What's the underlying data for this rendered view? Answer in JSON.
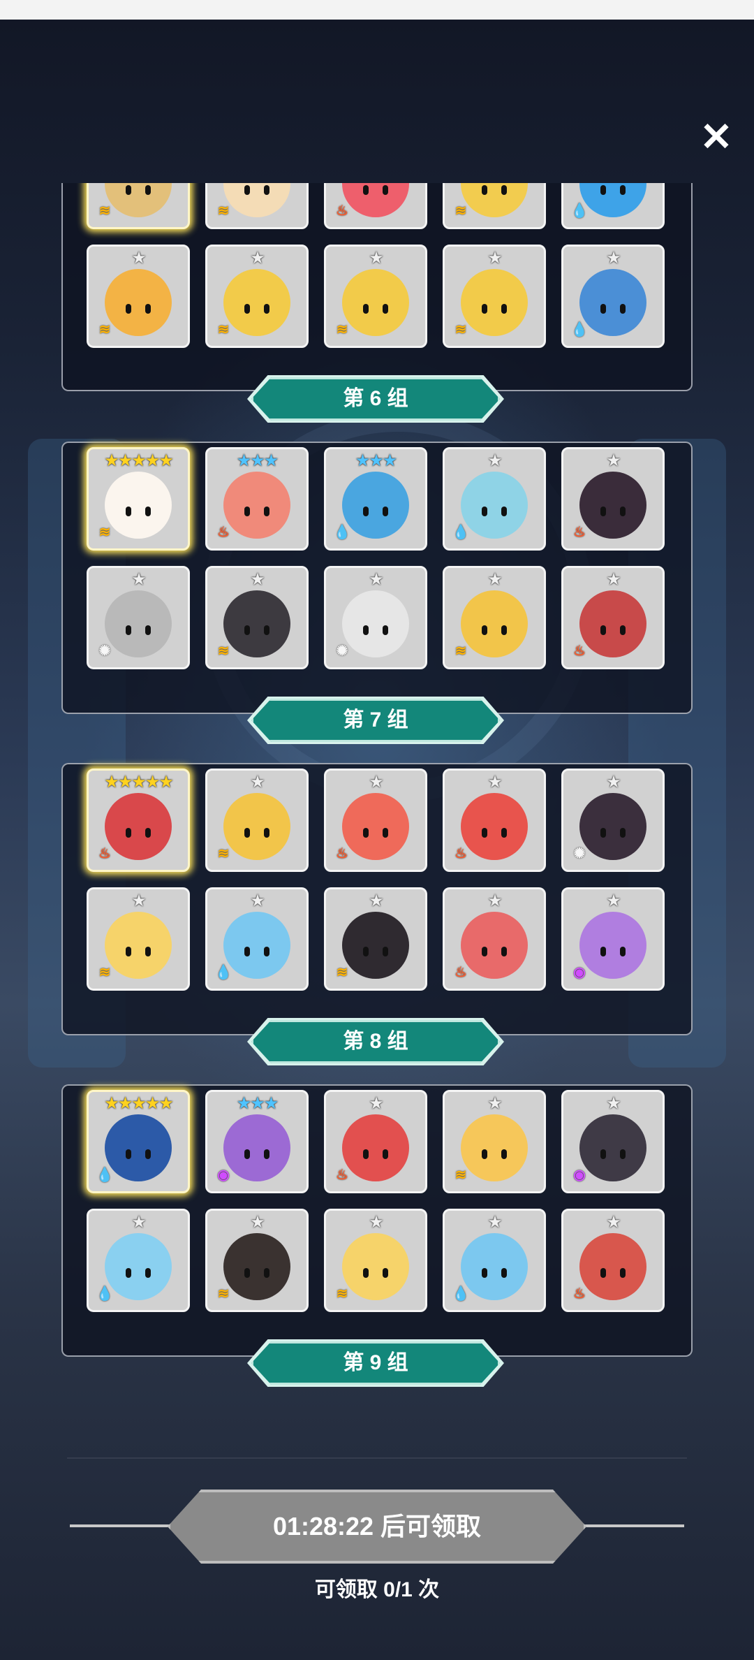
{
  "close_glyph": "✕",
  "groups": [
    {
      "label": "第 6 组",
      "cards": [
        {
          "stars": "★★★★★",
          "star_color": "gold",
          "element": "wind",
          "color": "#e3c07a",
          "glow": true
        },
        {
          "stars": "★★★",
          "star_color": "blue",
          "element": "wind",
          "color": "#f4dcb6",
          "glow": false
        },
        {
          "stars": "★",
          "star_color": "white",
          "element": "fire",
          "color": "#ee5f6c",
          "glow": false
        },
        {
          "stars": "★",
          "star_color": "white",
          "element": "wind",
          "color": "#f2cc4f",
          "glow": false
        },
        {
          "stars": "★",
          "star_color": "white",
          "element": "water",
          "color": "#3ea3e8",
          "glow": false
        },
        {
          "stars": "★",
          "star_color": "white",
          "element": "wind",
          "color": "#f3b345",
          "glow": false
        },
        {
          "stars": "★",
          "star_color": "white",
          "element": "wind",
          "color": "#f2cb4a",
          "glow": false
        },
        {
          "stars": "★",
          "star_color": "white",
          "element": "wind",
          "color": "#f2cb4a",
          "glow": false
        },
        {
          "stars": "★",
          "star_color": "white",
          "element": "wind",
          "color": "#f2cb4a",
          "glow": false
        },
        {
          "stars": "★",
          "star_color": "white",
          "element": "water",
          "color": "#4b8fd6",
          "glow": false
        }
      ]
    },
    {
      "label": "第 7 组",
      "cards": [
        {
          "stars": "★★★★★",
          "star_color": "gold",
          "element": "wind",
          "color": "#fbf5ee",
          "glow": true
        },
        {
          "stars": "★★★",
          "star_color": "blue",
          "element": "fire",
          "color": "#f08a7a",
          "glow": false
        },
        {
          "stars": "★★★",
          "star_color": "blue",
          "element": "water",
          "color": "#4aa6e0",
          "glow": false
        },
        {
          "stars": "★",
          "star_color": "white",
          "element": "water",
          "color": "#8fd3e6",
          "glow": false
        },
        {
          "stars": "★",
          "star_color": "white",
          "element": "fire",
          "color": "#3a2c3a",
          "glow": false
        },
        {
          "stars": "★",
          "star_color": "white",
          "element": "light",
          "color": "#b9b9b9",
          "glow": false
        },
        {
          "stars": "★",
          "star_color": "white",
          "element": "wind",
          "color": "#3d3a40",
          "glow": false
        },
        {
          "stars": "★",
          "star_color": "white",
          "element": "light",
          "color": "#e6e6e6",
          "glow": false
        },
        {
          "stars": "★",
          "star_color": "white",
          "element": "wind",
          "color": "#f2c54a",
          "glow": false
        },
        {
          "stars": "★",
          "star_color": "white",
          "element": "fire",
          "color": "#c84a4a",
          "glow": false
        }
      ]
    },
    {
      "label": "第 8 组",
      "cards": [
        {
          "stars": "★★★★★",
          "star_color": "gold",
          "element": "fire",
          "color": "#d9484b",
          "glow": true
        },
        {
          "stars": "★",
          "star_color": "white",
          "element": "wind",
          "color": "#f2c54a",
          "glow": false
        },
        {
          "stars": "★",
          "star_color": "white",
          "element": "fire",
          "color": "#ef6a5a",
          "glow": false
        },
        {
          "stars": "★",
          "star_color": "white",
          "element": "fire",
          "color": "#e8544d",
          "glow": false
        },
        {
          "stars": "★",
          "star_color": "white",
          "element": "light",
          "color": "#3b2f3d",
          "glow": false
        },
        {
          "stars": "★",
          "star_color": "white",
          "element": "wind",
          "color": "#f6d36a",
          "glow": false
        },
        {
          "stars": "★",
          "star_color": "white",
          "element": "water",
          "color": "#7cc8ef",
          "glow": false
        },
        {
          "stars": "★",
          "star_color": "white",
          "element": "wind",
          "color": "#2f2a30",
          "glow": false
        },
        {
          "stars": "★",
          "star_color": "white",
          "element": "fire",
          "color": "#e86a6a",
          "glow": false
        },
        {
          "stars": "★",
          "star_color": "white",
          "element": "dark",
          "color": "#b07ee0",
          "glow": false
        }
      ]
    },
    {
      "label": "第 9 组",
      "cards": [
        {
          "stars": "★★★★★",
          "star_color": "gold",
          "element": "water",
          "color": "#2c5aa8",
          "glow": true
        },
        {
          "stars": "★★★",
          "star_color": "blue",
          "element": "dark",
          "color": "#9c6ad4",
          "glow": false
        },
        {
          "stars": "★",
          "star_color": "white",
          "element": "fire",
          "color": "#e2504f",
          "glow": false
        },
        {
          "stars": "★",
          "star_color": "white",
          "element": "wind",
          "color": "#f6c75a",
          "glow": false
        },
        {
          "stars": "★",
          "star_color": "white",
          "element": "dark",
          "color": "#3f3a46",
          "glow": false
        },
        {
          "stars": "★",
          "star_color": "white",
          "element": "water",
          "color": "#8ad0f0",
          "glow": false
        },
        {
          "stars": "★",
          "star_color": "white",
          "element": "wind",
          "color": "#3a3230",
          "glow": false
        },
        {
          "stars": "★",
          "star_color": "white",
          "element": "wind",
          "color": "#f6d36a",
          "glow": false
        },
        {
          "stars": "★",
          "star_color": "white",
          "element": "water",
          "color": "#7cc8ef",
          "glow": false
        },
        {
          "stars": "★",
          "star_color": "white",
          "element": "fire",
          "color": "#d8574d",
          "glow": false
        }
      ]
    }
  ],
  "claim": {
    "button_label": "01:28:22 后可领取",
    "count_label": "可领取 0/1 次"
  }
}
